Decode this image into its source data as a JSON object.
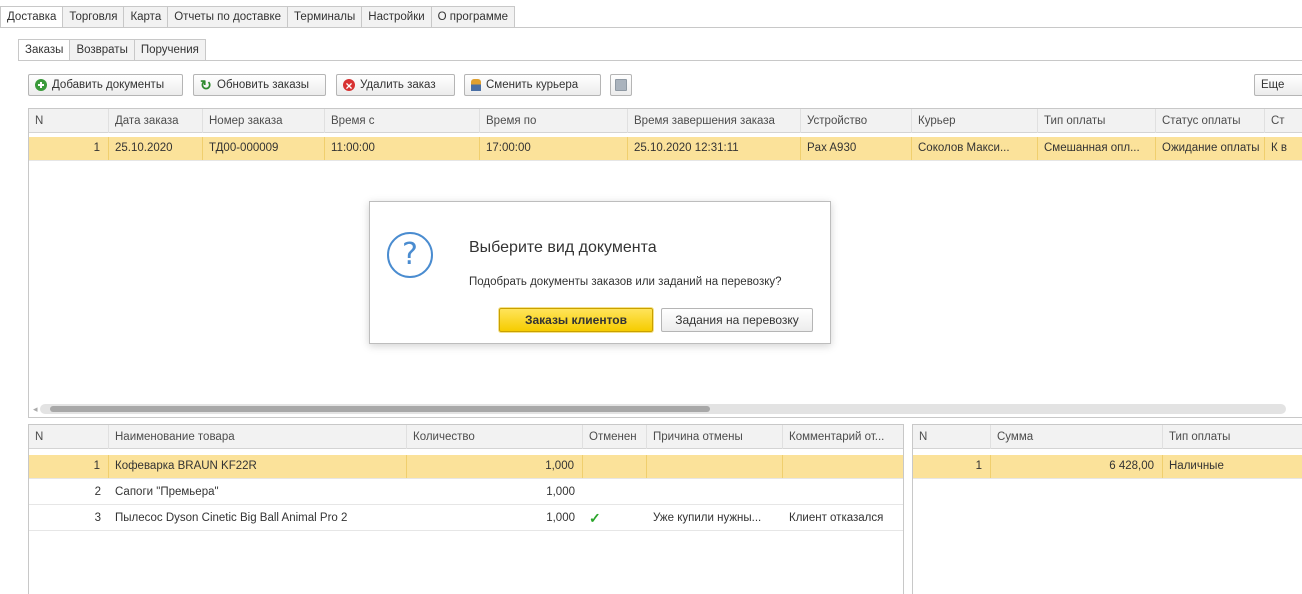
{
  "main_tabs": [
    "Доставка",
    "Торговля",
    "Карта",
    "Отчеты по доставке",
    "Терминалы",
    "Настройки",
    "О программе"
  ],
  "sub_tabs": [
    "Заказы",
    "Возвраты",
    "Поручения"
  ],
  "toolbar": {
    "add_label": "Добавить документы",
    "refresh_label": "Обновить заказы",
    "delete_label": "Удалить заказ",
    "courier_label": "Сменить курьера",
    "more_label": "Еще"
  },
  "orders": {
    "headers": [
      "N",
      "Дата заказа",
      "Номер заказа",
      "Время с",
      "Время по",
      "Время завершения заказа",
      "Устройство",
      "Курьер",
      "Тип оплаты",
      "Статус оплаты",
      "Ст"
    ],
    "rows": [
      [
        "1",
        "25.10.2020",
        "ТД00-000009",
        "11:00:00",
        "17:00:00",
        "25.10.2020 12:31:11",
        "Pax A930",
        "Соколов Макси...",
        "Смешанная опл...",
        "Ожидание оплаты",
        "К в"
      ]
    ]
  },
  "goods": {
    "headers": [
      "N",
      "Наименование товара",
      "Количество",
      "Отменен",
      "Причина отмены",
      "Комментарий от..."
    ],
    "rows": [
      [
        "1",
        "Кофеварка BRAUN KF22R",
        "1,000",
        "",
        "",
        ""
      ],
      [
        "2",
        "Сапоги \"Премьера\"",
        "1,000",
        "",
        "",
        ""
      ],
      [
        "3",
        "Пылесос Dyson Cinetic Big Ball Animal Pro 2",
        "1,000",
        "✓",
        "Уже купили нужны...",
        "Клиент отказался"
      ]
    ]
  },
  "payments": {
    "headers": [
      "N",
      "Сумма",
      "Тип оплаты"
    ],
    "rows": [
      [
        "1",
        "6 428,00",
        "Наличные"
      ]
    ]
  },
  "dialog": {
    "title": "Выберите вид документа",
    "text": "Подобрать документы заказов или заданий на перевозку?",
    "primary_label": "Заказы клиентов",
    "secondary_label": "Задания на перевозку"
  },
  "icons": {
    "add": "plus-circle-icon",
    "refresh": "refresh-icon",
    "delete": "delete-circle-icon",
    "courier": "person-icon",
    "question": "question-icon",
    "check": "check-icon"
  },
  "colors": {
    "selected_row": "#fbe29a",
    "primary_button": "#f6cc00",
    "check": "#2aa52a",
    "question_icon": "#4a8cd0"
  }
}
